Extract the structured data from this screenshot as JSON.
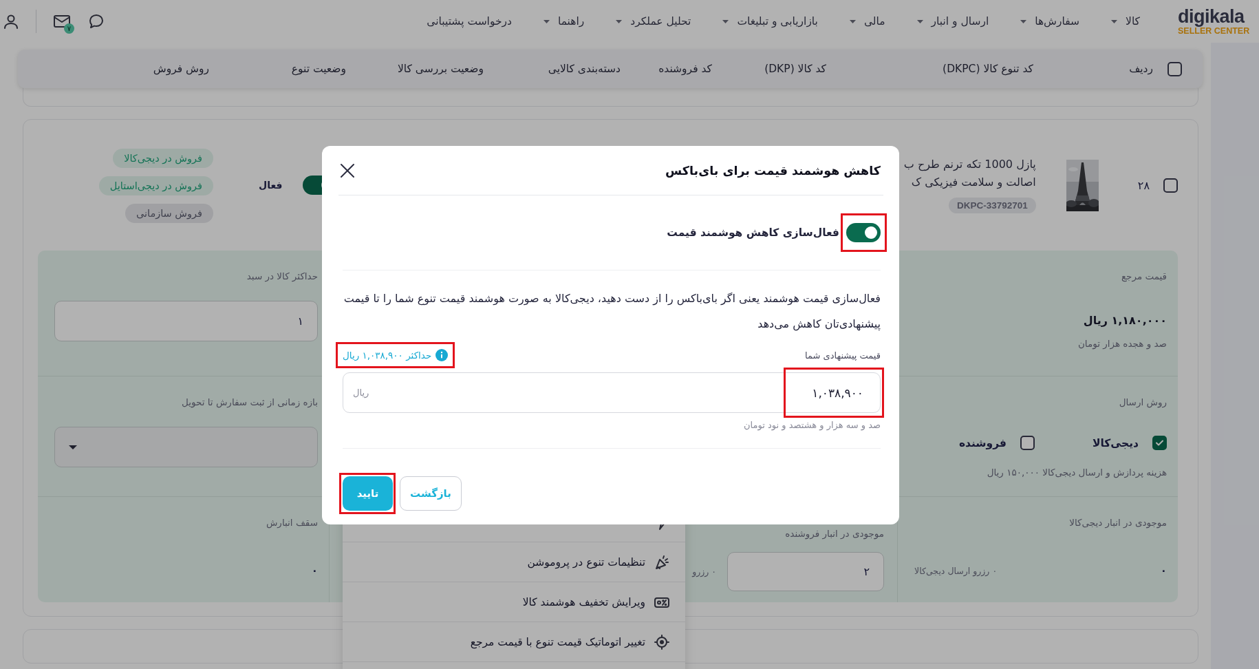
{
  "header": {
    "logo": "digikala",
    "logo_tagline": "SELLER CENTER",
    "menu": [
      {
        "label": "کالا",
        "dropdown": true
      },
      {
        "label": "سفارش‌ها",
        "dropdown": true
      },
      {
        "label": "ارسال و انبار",
        "dropdown": true
      },
      {
        "label": "مالی",
        "dropdown": true
      },
      {
        "label": "بازاریابی و تبلیغات",
        "dropdown": true
      },
      {
        "label": "تحلیل عملکرد",
        "dropdown": true
      },
      {
        "label": "راهنما",
        "dropdown": true
      },
      {
        "label": "درخواست پشتیبانی",
        "dropdown": false
      }
    ],
    "mail_badge": "۷"
  },
  "table_header": {
    "checked": false,
    "columns": [
      "ردیف",
      "کد تنوع کالا (DKPC)",
      "کد کالا (DKP)",
      "کد فروشنده",
      "دسته‌بندی کالایی",
      "وضعیت بررسی کالا",
      "وضعیت تنوع",
      "روش فروش"
    ]
  },
  "product": {
    "checked": false,
    "row_number": "۲۸",
    "image": {
      "kind": "picture"
    },
    "title_lines": [
      "پازل 1000 تکه ترنم طرح ب",
      "اصالت و سلامت فیزیکی ک"
    ],
    "dkpc": "DKPC-33792701",
    "status": {
      "label": "فعال",
      "on": true
    },
    "channels": [
      {
        "label": "فروش در دیجی‌کالا",
        "active": true
      },
      {
        "label": "فروش در دیجی‌استایل",
        "active": true
      },
      {
        "label": "فروش سازمانی",
        "active": false
      }
    ],
    "reference_price": {
      "label": "قیمت مرجع",
      "value": "۱,۱۸۰,۰۰۰ ریال",
      "in_words": "صد و هجده هزار تومان"
    },
    "max_in_cart": {
      "label": "حداکثر کالا در سبد",
      "value": "۱"
    },
    "shipping": {
      "label": "روش ارسال",
      "options": [
        {
          "label": "دیجی‌کالا",
          "checked": true
        },
        {
          "label": "فروشنده",
          "checked": false
        }
      ],
      "note": "هزینه پردازش و ارسال دیجی‌کالا ۱۵۰,۰۰۰ ریال"
    },
    "delivery_window": {
      "label": "بازه زمانی از ثبت سفارش تا تحویل"
    },
    "digikala_stock": {
      "label": "موجودی در انبار دیجی‌کالا",
      "value": "۰",
      "reserved": "۰ رزرو ارسال دیجی‌کالا"
    },
    "seller_stock": {
      "label": "موجودی در انبار فروشنده",
      "value": "۲",
      "reserved": "۰ رزرو"
    },
    "storage_cap": {
      "label": "سقف انبارش",
      "value": "۰"
    }
  },
  "actions_menu": [
    {
      "label": "تنظیمات تنوع در پروموشن"
    },
    {
      "label": "ویرایش تخفیف هوشمند کالا"
    },
    {
      "label": "تغییر اتوماتیک قیمت تنوع با قیمت مرجع"
    }
  ],
  "modal": {
    "title": "کاهش هوشمند قیمت برای بای‌باکس",
    "toggle": {
      "label": "فعال‌سازی کاهش هوشمند قیمت",
      "on": true,
      "highlighted": true
    },
    "description": "فعال‌سازی قیمت هوشمند یعنی اگر بای‌باکس را از دست دهید، دیجی‌کالا به صورت هوشمند قیمت تنوع شما را تا قیمت پیشنهادی‌تان کاهش می‌دهد",
    "price": {
      "label": "قیمت پیشنهادی شما",
      "max_hint": "حداکثر ۱,۰۳۸,۹۰۰ ریال",
      "max_hint_highlighted": true,
      "value": "۱,۰۳۸,۹۰۰",
      "value_highlighted": true,
      "unit": "ریال",
      "in_words": "صد و سه هزار و هشتصد و نود تومان"
    },
    "buttons": [
      {
        "label": "بازگشت",
        "kind": "secondary",
        "highlighted": false
      },
      {
        "label": "تایید",
        "kind": "primary",
        "highlighted": true
      }
    ]
  }
}
